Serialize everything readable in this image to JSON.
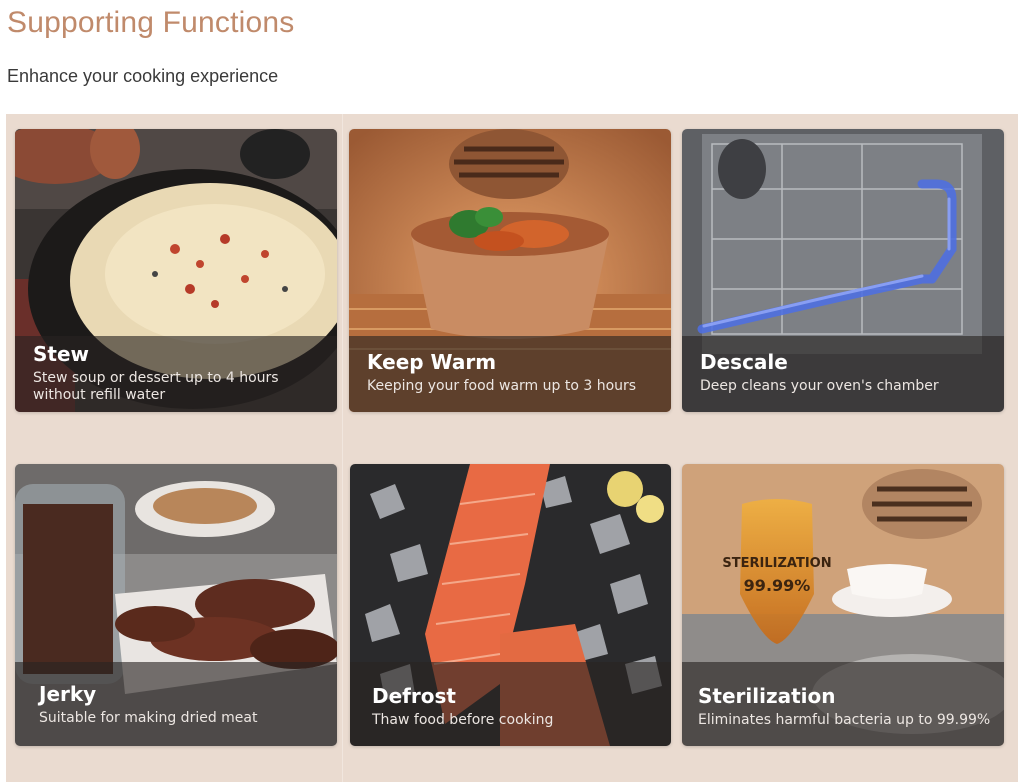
{
  "header": {
    "title": "Supporting Functions",
    "subtitle": "Enhance your cooking experience"
  },
  "colors": {
    "title": "#c08a6b",
    "panel_background": "#eadbd0",
    "caption_overlay": "rgba(40,36,34,0.62)"
  },
  "cards": [
    {
      "title": "Stew",
      "description": "Stew soup or dessert up to 4 hours without refill water",
      "image": "stew-pot-image"
    },
    {
      "title": "Keep Warm",
      "description": "Keeping your food warm up to 3 hours",
      "image": "warm-bowl-in-oven-image"
    },
    {
      "title": "Descale",
      "description": "Deep cleans your oven's chamber",
      "image": "oven-water-pipe-image"
    },
    {
      "title": "Jerky",
      "description": "Suitable for making dried meat",
      "image": "dried-meat-jar-image"
    },
    {
      "title": "Defrost",
      "description": "Thaw food before cooking",
      "image": "salmon-on-ice-image"
    },
    {
      "title": "Sterilization",
      "description": "Eliminates harmful bacteria up to 99.99%",
      "image": "sterilization-shield-image",
      "badge_text": "STERILIZATION",
      "badge_value": "99.99%"
    }
  ]
}
